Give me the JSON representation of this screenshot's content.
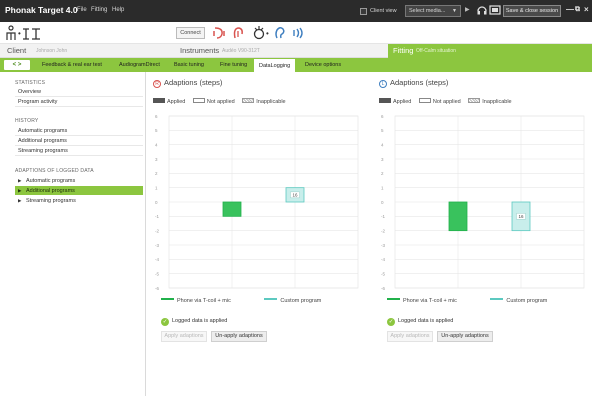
{
  "titlebar": {
    "app_name": "Phonak Target 4.0",
    "menus": [
      "File",
      "Fitting",
      "Help"
    ],
    "client_view_label": "Client view",
    "select_media_label": "Select media...",
    "save_close_label": "Save & close session",
    "minimize_glyph": "—",
    "restore_glyph": "⧉",
    "close_glyph": "×"
  },
  "header": {
    "connect_label": "Connect",
    "client": {
      "title": "Client",
      "subtitle": "Johnson John"
    },
    "instruments": {
      "title": "Instruments",
      "subtitle": "Audéo V90-312T"
    },
    "fitting": {
      "title": "Fitting",
      "subtitle": "Off-Calm situation"
    }
  },
  "tabs": {
    "arrows": "< >",
    "items": [
      {
        "label": "Feedback & real ear test",
        "active": false
      },
      {
        "label": "AudiogramDirect",
        "active": false
      },
      {
        "label": "Basic tuning",
        "active": false
      },
      {
        "label": "Fine tuning",
        "active": false
      },
      {
        "label": "DataLogging",
        "active": true
      },
      {
        "label": "Device options",
        "active": false
      }
    ]
  },
  "sidebar": {
    "statistics": {
      "heading": "STATISTICS",
      "items": [
        "Overview",
        "Program activity"
      ]
    },
    "history": {
      "heading": "HISTORY",
      "items": [
        "Automatic programs",
        "Additional programs",
        "Streaming programs"
      ]
    },
    "adaptions": {
      "heading": "ADAPTIONS OF LOGGED DATA",
      "items": [
        {
          "label": "Automatic programs",
          "selected": false
        },
        {
          "label": "Additional programs",
          "selected": true
        },
        {
          "label": "Streaming programs",
          "selected": false
        }
      ]
    }
  },
  "panels": [
    {
      "side": "right",
      "side_marker": "R",
      "side_color": "#d9534f",
      "title": "Adaptions (steps)",
      "legend": {
        "applied": "Applied",
        "not_applied": "Not applied",
        "inapplicable": "Inapplicable"
      },
      "chart_data": {
        "type": "bar",
        "ylim": [
          -6,
          6
        ],
        "yticks": [
          6,
          5,
          4,
          3,
          2,
          1,
          0,
          -1,
          -2,
          -3,
          -4,
          -5,
          -6
        ],
        "series": [
          {
            "name": "Phone via T-coil + mic",
            "color": "#21b14b",
            "fill": "#39c25d",
            "value": -1,
            "label": ""
          },
          {
            "name": "Custom program",
            "color": "#5cc9c0",
            "fill": "#c8eeeb",
            "value": 1,
            "label": "16"
          }
        ]
      },
      "logged_text": "Logged data is applied",
      "apply_label": "Apply adaptions",
      "unapply_label": "Un-apply adaptions"
    },
    {
      "side": "left",
      "side_marker": "L",
      "side_color": "#3f7fc0",
      "title": "Adaptions (steps)",
      "legend": {
        "applied": "Applied",
        "not_applied": "Not applied",
        "inapplicable": "Inapplicable"
      },
      "chart_data": {
        "type": "bar",
        "ylim": [
          -6,
          6
        ],
        "yticks": [
          6,
          5,
          4,
          3,
          2,
          1,
          0,
          -1,
          -2,
          -3,
          -4,
          -5,
          -6
        ],
        "series": [
          {
            "name": "Phone via T-coil + mic",
            "color": "#21b14b",
            "fill": "#39c25d",
            "value": -2,
            "label": ""
          },
          {
            "name": "Custom program",
            "color": "#5cc9c0",
            "fill": "#c8eeeb",
            "value": -2,
            "label": "16"
          }
        ]
      },
      "logged_text": "Logged data is applied",
      "apply_label": "Apply adaptions",
      "unapply_label": "Un-apply adaptions"
    }
  ]
}
